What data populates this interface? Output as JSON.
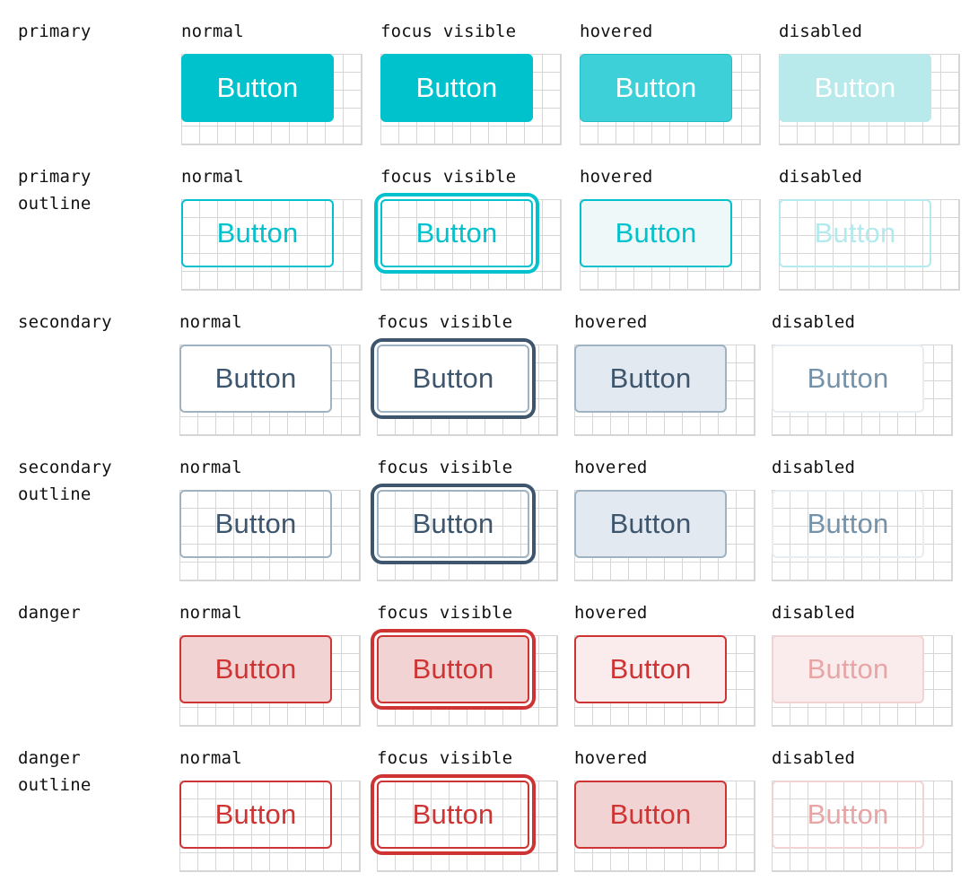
{
  "button_text": "Button",
  "states": {
    "normal": "normal",
    "focus": "focus visible",
    "hovered": "hovered",
    "disabled": "disabled"
  },
  "variants": [
    {
      "id": "primary",
      "label": "primary"
    },
    {
      "id": "primary-outline",
      "label": "primary\noutline"
    },
    {
      "id": "secondary",
      "label": "secondary"
    },
    {
      "id": "secondary-outline",
      "label": "secondary\noutline"
    },
    {
      "id": "danger",
      "label": "danger"
    },
    {
      "id": "danger-outline",
      "label": "danger\noutline"
    }
  ],
  "colors": {
    "primary": "#00c2cd",
    "secondary_text": "#3d566e",
    "danger": "#cf3434",
    "grid_line": "#d6d6d6"
  }
}
